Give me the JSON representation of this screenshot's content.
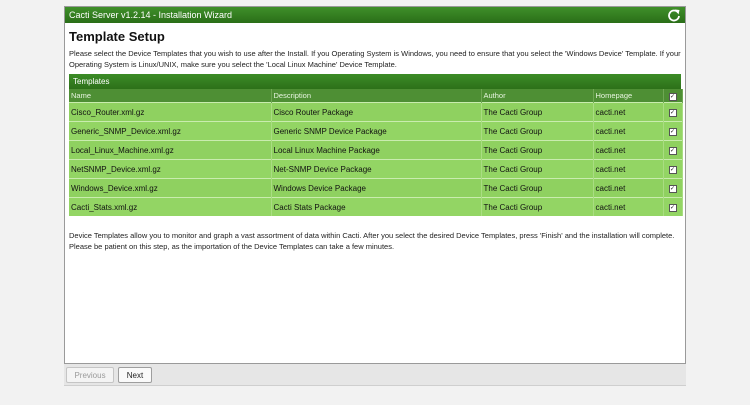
{
  "window": {
    "title": "Cacti Server v1.2.14 - Installation Wizard"
  },
  "page": {
    "title": "Template Setup",
    "intro": "Please select the Device Templates that you wish to use after the Install. If you Operating System is Windows, you need to ensure that you select the 'Windows Device' Template. If your Operating System is Linux/UNIX, make sure you select the 'Local Linux Machine' Device Template.",
    "outro": "Device Templates allow you to monitor and graph a vast assortment of data within Cacti. After you select the desired Device Templates, press 'Finish' and the installation will complete. Please be patient on this step, as the importation of the Device Templates can take a few minutes."
  },
  "templates": {
    "panel_title": "Templates",
    "columns": [
      "Name",
      "Description",
      "Author",
      "Homepage"
    ],
    "rows": [
      {
        "name": "Cisco_Router.xml.gz",
        "description": "Cisco Router Package",
        "author": "The Cacti Group",
        "homepage": "cacti.net",
        "checked": true
      },
      {
        "name": "Generic_SNMP_Device.xml.gz",
        "description": "Generic SNMP Device Package",
        "author": "The Cacti Group",
        "homepage": "cacti.net",
        "checked": true
      },
      {
        "name": "Local_Linux_Machine.xml.gz",
        "description": "Local Linux Machine Package",
        "author": "The Cacti Group",
        "homepage": "cacti.net",
        "checked": true
      },
      {
        "name": "NetSNMP_Device.xml.gz",
        "description": "Net-SNMP Device Package",
        "author": "The Cacti Group",
        "homepage": "cacti.net",
        "checked": true
      },
      {
        "name": "Windows_Device.xml.gz",
        "description": "Windows Device Package",
        "author": "The Cacti Group",
        "homepage": "cacti.net",
        "checked": true
      },
      {
        "name": "Cacti_Stats.xml.gz",
        "description": "Cacti Stats Package",
        "author": "The Cacti Group",
        "homepage": "cacti.net",
        "checked": true
      }
    ]
  },
  "buttons": {
    "previous": "Previous",
    "next": "Next"
  },
  "colors": {
    "header_green": "#2e7d1e",
    "row_green": "#8fd160"
  }
}
